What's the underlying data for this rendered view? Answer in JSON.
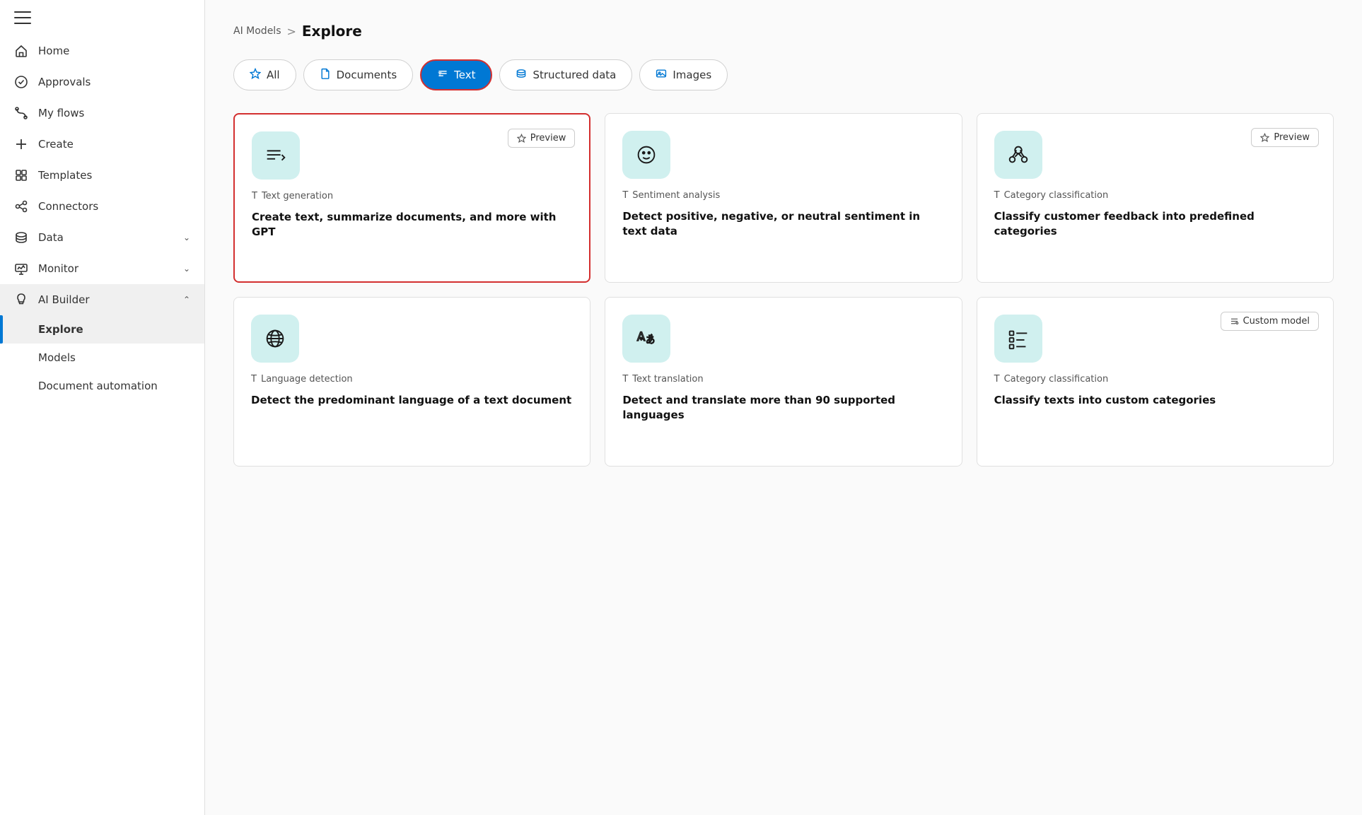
{
  "sidebar": {
    "nav_items": [
      {
        "id": "home",
        "label": "Home",
        "icon": "home-icon"
      },
      {
        "id": "approvals",
        "label": "Approvals",
        "icon": "approvals-icon"
      },
      {
        "id": "my-flows",
        "label": "My flows",
        "icon": "flows-icon"
      },
      {
        "id": "create",
        "label": "Create",
        "icon": "create-icon"
      },
      {
        "id": "templates",
        "label": "Templates",
        "icon": "templates-icon"
      },
      {
        "id": "connectors",
        "label": "Connectors",
        "icon": "connectors-icon"
      },
      {
        "id": "data",
        "label": "Data",
        "icon": "data-icon",
        "has_chevron": true
      },
      {
        "id": "monitor",
        "label": "Monitor",
        "icon": "monitor-icon",
        "has_chevron": true
      },
      {
        "id": "ai-builder",
        "label": "AI Builder",
        "icon": "ai-builder-icon",
        "has_chevron": true,
        "expanded": true
      }
    ],
    "sub_items": [
      {
        "id": "explore",
        "label": "Explore",
        "active": true
      },
      {
        "id": "models",
        "label": "Models",
        "active": false
      },
      {
        "id": "document-automation",
        "label": "Document automation",
        "active": false
      }
    ]
  },
  "breadcrumb": {
    "parent": "AI Models",
    "separator": ">",
    "current": "Explore"
  },
  "tabs": [
    {
      "id": "all",
      "label": "All",
      "icon": "star-icon",
      "active": false
    },
    {
      "id": "documents",
      "label": "Documents",
      "icon": "document-icon",
      "active": false
    },
    {
      "id": "text",
      "label": "Text",
      "icon": "text-icon",
      "active": true
    },
    {
      "id": "structured-data",
      "label": "Structured data",
      "icon": "structured-icon",
      "active": false
    },
    {
      "id": "images",
      "label": "Images",
      "icon": "images-icon",
      "active": false
    }
  ],
  "cards": [
    {
      "id": "text-generation",
      "category": "Text generation",
      "title": "Create text, summarize documents, and more with GPT",
      "icon": "text-gen-icon",
      "badge": "Preview",
      "selected": true
    },
    {
      "id": "sentiment-analysis",
      "category": "Sentiment analysis",
      "title": "Detect positive, negative, or neutral sentiment in text data",
      "icon": "sentiment-icon",
      "badge": null,
      "selected": false
    },
    {
      "id": "category-classification",
      "category": "Category classification",
      "title": "Classify customer feedback into predefined categories",
      "icon": "category-icon",
      "badge": "Preview",
      "selected": false
    },
    {
      "id": "language-detection",
      "category": "Language detection",
      "title": "Detect the predominant language of a text document",
      "icon": "language-icon",
      "badge": null,
      "selected": false
    },
    {
      "id": "text-translation",
      "category": "Text translation",
      "title": "Detect and translate more than 90 supported languages",
      "icon": "translation-icon",
      "badge": null,
      "selected": false
    },
    {
      "id": "category-classification-custom",
      "category": "Category classification",
      "title": "Classify texts into custom categories",
      "icon": "custom-category-icon",
      "badge": "Custom model",
      "selected": false
    }
  ],
  "icons": {
    "preview_label": "Preview",
    "custom_model_label": "Custom model"
  }
}
